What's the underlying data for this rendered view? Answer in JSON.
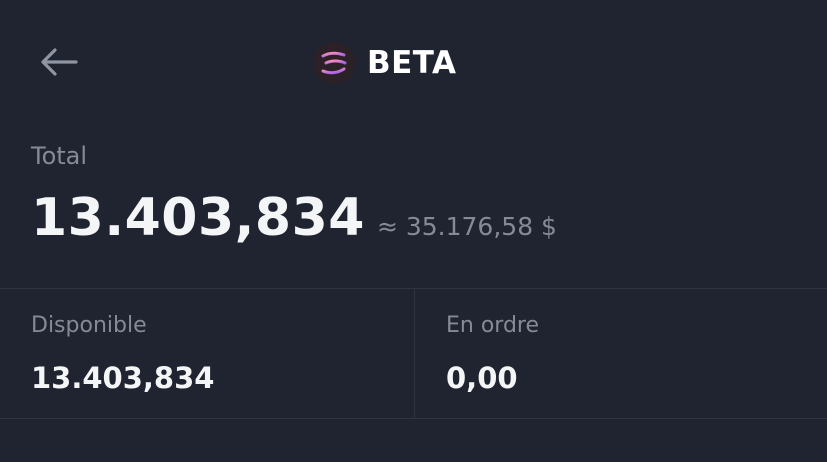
{
  "header": {
    "back_icon": "arrow-left-icon",
    "coin_icon": "beta-coin-logo",
    "coin_name": "BETA"
  },
  "total": {
    "label": "Total",
    "value": "13.403,834",
    "fiat_value": "≈ 35.176,58 $"
  },
  "available": {
    "label": "Disponible",
    "value": "13.403,834"
  },
  "in_order": {
    "label": "En ordre",
    "value": "0,00"
  },
  "colors": {
    "background": "#1f2430",
    "primary_text": "#f4f5f7",
    "secondary_text": "#858a96",
    "divider": "#2e3442"
  }
}
